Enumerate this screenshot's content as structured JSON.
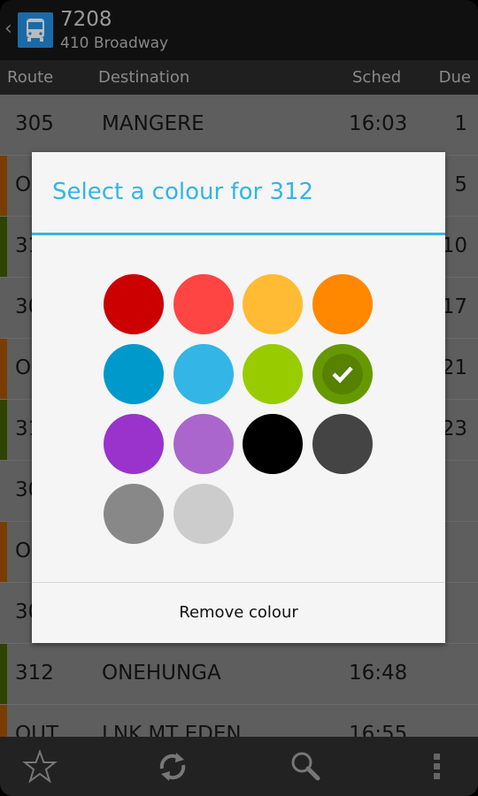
{
  "header": {
    "title": "7208",
    "subtitle": "410 Broadway",
    "icon": "bus-icon"
  },
  "columns": {
    "route": "Route",
    "destination": "Destination",
    "sched": "Sched",
    "due": "Due"
  },
  "rows": [
    {
      "route": "305",
      "destination": "MANGERE",
      "sched": "16:03",
      "due": "1",
      "stripe": ""
    },
    {
      "route": "O",
      "destination": "",
      "sched": "",
      "due": "5",
      "stripe": "#7a3d00"
    },
    {
      "route": "31",
      "destination": "",
      "sched": "",
      "due": "10",
      "stripe": "#2f4400"
    },
    {
      "route": "30",
      "destination": "",
      "sched": "",
      "due": "17",
      "stripe": ""
    },
    {
      "route": "O",
      "destination": "",
      "sched": "",
      "due": "21",
      "stripe": "#7a3d00"
    },
    {
      "route": "31",
      "destination": "",
      "sched": "",
      "due": "23",
      "stripe": "#2f4400"
    },
    {
      "route": "30",
      "destination": "",
      "sched": "",
      "due": "",
      "stripe": ""
    },
    {
      "route": "O",
      "destination": "",
      "sched": "",
      "due": "",
      "stripe": "#7a3d00"
    },
    {
      "route": "30",
      "destination": "",
      "sched": "",
      "due": "",
      "stripe": ""
    },
    {
      "route": "312",
      "destination": "ONEHUNGA",
      "sched": "16:48",
      "due": "",
      "stripe": "#2f4400"
    },
    {
      "route": "OUT",
      "destination": "LNK MT EDEN",
      "sched": "16:55",
      "due": "",
      "stripe": "#7a3d00"
    }
  ],
  "dialog": {
    "title": "Select a colour for 312",
    "accent": "#33b5e5",
    "swatches": [
      "#cc0000",
      "#ff4444",
      "#ffbb33",
      "#ff8800",
      "#0099cc",
      "#33b5e5",
      "#99cc00",
      "#669900",
      "#9933cc",
      "#aa66cc",
      "#000000",
      "#444444",
      "#888888",
      "#cccccc"
    ],
    "selected": "#669900",
    "remove_label": "Remove colour"
  },
  "bottom_bar": [
    "star-icon",
    "refresh-icon",
    "search-icon",
    "overflow-menu-icon"
  ]
}
